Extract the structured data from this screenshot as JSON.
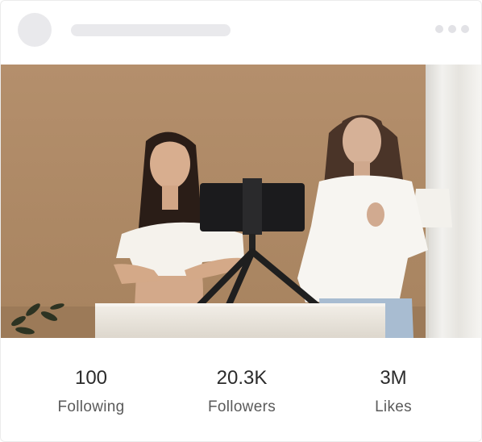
{
  "profile": {
    "more_icon": "more-horizontal-icon"
  },
  "stats": [
    {
      "value": "100",
      "label": "Following"
    },
    {
      "value": "20.3K",
      "label": "Followers"
    },
    {
      "value": "3M",
      "label": "Likes"
    }
  ],
  "colors": {
    "wall": "#b18f70",
    "placeholder": "#e9e9ec",
    "text": "#2b2b2b"
  }
}
